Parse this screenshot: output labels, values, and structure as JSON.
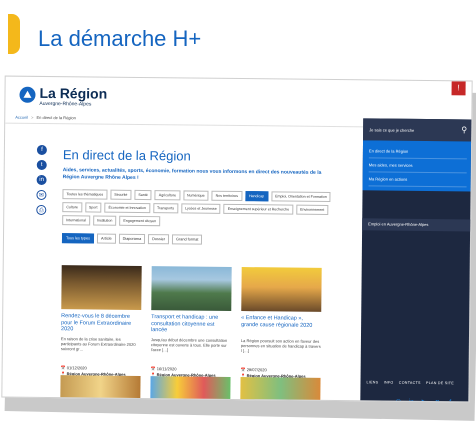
{
  "heading": "La démarche H+",
  "brand": {
    "title": "La Région",
    "subtitle": "Auvergne-Rhône-Alpes",
    "alert": "!"
  },
  "breadcrumb": {
    "home": "Accueil",
    "separator": ">",
    "current": "En direct de la Région"
  },
  "social": [
    "f",
    "t",
    "in",
    "✉",
    "⎙"
  ],
  "page": {
    "title": "En direct de la Région",
    "intro": "Aides, services, actualités, sports, économie, formation nous vous informons en direct des nouveautés de la Région Auvergne Rhône Alpes !"
  },
  "tags": [
    {
      "label": "Toutes les thématiques",
      "active": false
    },
    {
      "label": "Sécurité",
      "active": false
    },
    {
      "label": "Santé",
      "active": false
    },
    {
      "label": "Agriculture",
      "active": false
    },
    {
      "label": "Numérique",
      "active": false
    },
    {
      "label": "Nos territoires",
      "active": false
    },
    {
      "label": "Handicap",
      "active": true
    },
    {
      "label": "Emploi, Orientation et Formation",
      "active": false
    },
    {
      "label": "Culture",
      "active": false
    },
    {
      "label": "Sport",
      "active": false
    },
    {
      "label": "Économie et Innovation",
      "active": false
    },
    {
      "label": "Transports",
      "active": false
    },
    {
      "label": "Lycées et Jeunesse",
      "active": false
    },
    {
      "label": "Enseignement supérieur et Recherche",
      "active": false
    },
    {
      "label": "Environnement",
      "active": false
    },
    {
      "label": "International",
      "active": false
    },
    {
      "label": "Institution",
      "active": false
    },
    {
      "label": "Engagement citoyen",
      "active": false
    }
  ],
  "types": [
    {
      "label": "Tous les types",
      "active": true
    },
    {
      "label": "Article",
      "active": false
    },
    {
      "label": "Diaporama",
      "active": false
    },
    {
      "label": "Dossier",
      "active": false
    },
    {
      "label": "Grand format",
      "active": false
    }
  ],
  "cards": [
    {
      "title": "Rendez-vous le 8 décembre pour le Forum Extraordinaire 2020",
      "text": "En raison de la crise sanitaire, les participants au Forum Extraordinaire 2020 suivront gr…",
      "date": "📅 01/12/2020",
      "location": "📍 Région Auvergne-Rhône-Alpes",
      "img": "img1"
    },
    {
      "title": "Transport et handicap : une consultation citoyenne est lancée",
      "text": "Jusqu'au début décembre une consultation citoyenne est ouverte à tous. Elle porte sur l'acce […]",
      "date": "📅 16/11/2020",
      "location": "📍 Région Auvergne-Rhône-Alpes",
      "img": "img2"
    },
    {
      "title": "« Enfance et Handicap », grande cause régionale 2020",
      "text": "La Région poursuit son action en faveur des personnes en situation de handicap à travers l […]",
      "date": "📅 29/07/2020",
      "location": "📍 Région Auvergne-Rhône-Alpes",
      "img": "img3"
    }
  ],
  "cards_row2": [
    "img4",
    "img5",
    "img6"
  ],
  "panel": {
    "search_label": "Je sais ce que je cherche",
    "menu": [
      "En direct de la Région",
      "Mes aides, mes services",
      "Ma Région en actions"
    ],
    "employment": "Emploi en Auvergne-Rhône-Alpes",
    "links": [
      "LIENS",
      "INFO",
      "CONTACTS",
      "PLAN DE SITE"
    ],
    "socials": [
      "◎",
      "in",
      "▶",
      "♥",
      "f"
    ]
  }
}
